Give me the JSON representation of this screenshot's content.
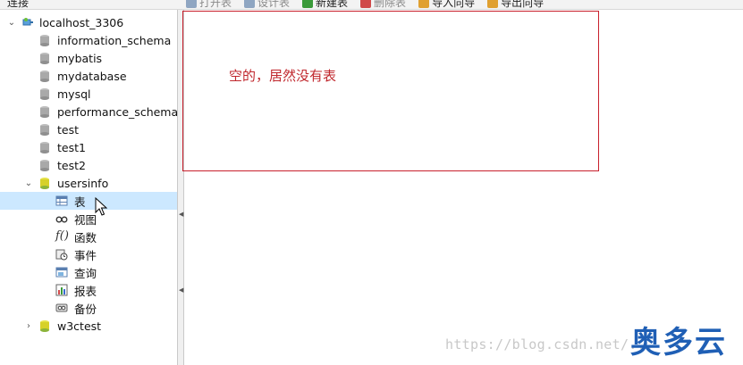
{
  "top": {
    "panel_label": "连接",
    "toolbar": [
      {
        "label": "打开表",
        "icon": "open-table-icon",
        "color": "#8fa6c2",
        "disabled": true
      },
      {
        "label": "设计表",
        "icon": "design-table-icon",
        "color": "#8fa6c2",
        "disabled": true
      },
      {
        "label": "新建表",
        "icon": "new-table-icon",
        "color": "#3a9a3a",
        "disabled": false
      },
      {
        "label": "删除表",
        "icon": "delete-table-icon",
        "color": "#d04a4a",
        "disabled": true
      },
      {
        "label": "导入向导",
        "icon": "import-wizard-icon",
        "color": "#e0a030",
        "disabled": false
      },
      {
        "label": "导出向导",
        "icon": "export-wizard-icon",
        "color": "#e0a030",
        "disabled": false
      }
    ]
  },
  "tree": {
    "connection": "localhost_3306",
    "databases": [
      "information_schema",
      "mybatis",
      "mydatabase",
      "mysql",
      "performance_schema",
      "test",
      "test1",
      "test2"
    ],
    "open_db": "usersinfo",
    "children": [
      {
        "label": "表",
        "icon": "table-icon",
        "selected": true
      },
      {
        "label": "视图",
        "icon": "view-glasses-icon",
        "selected": false
      },
      {
        "label": "函数",
        "icon": "function-icon",
        "selected": false
      },
      {
        "label": "事件",
        "icon": "event-icon",
        "selected": false
      },
      {
        "label": "查询",
        "icon": "query-icon",
        "selected": false
      },
      {
        "label": "报表",
        "icon": "report-icon",
        "selected": false
      },
      {
        "label": "备份",
        "icon": "backup-icon",
        "selected": false
      }
    ],
    "last_db": "w3ctest"
  },
  "annotation": {
    "text": "空的，居然没有表",
    "border_color": "#c8202c",
    "text_color": "#c0272d"
  },
  "watermark": {
    "url": "https://blog.csdn.net/...",
    "logo": "奥多云"
  }
}
